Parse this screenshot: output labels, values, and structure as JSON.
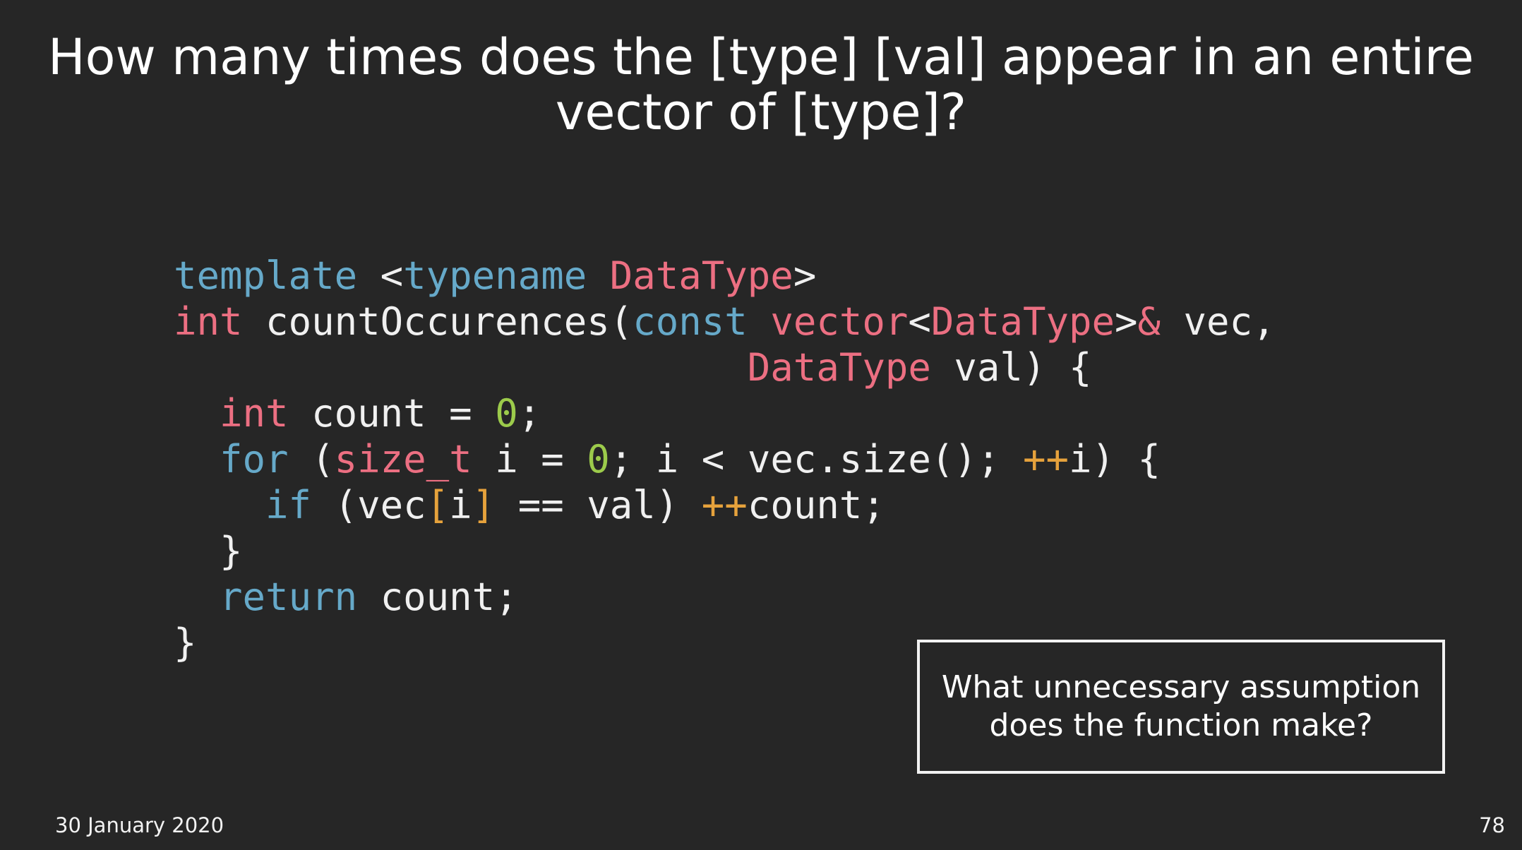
{
  "title": {
    "line1": "How many times does the [type] [val] appear in an entire",
    "line2": "vector of [type]?"
  },
  "code": {
    "lines": [
      [
        {
          "t": "template",
          "k": "kw"
        },
        {
          "t": " <",
          "k": "plain"
        },
        {
          "t": "typename",
          "k": "kw"
        },
        {
          "t": " ",
          "k": "plain"
        },
        {
          "t": "DataType",
          "k": "type"
        },
        {
          "t": ">",
          "k": "plain"
        }
      ],
      [
        {
          "t": "int",
          "k": "type"
        },
        {
          "t": " countOccurences(",
          "k": "plain"
        },
        {
          "t": "const",
          "k": "kw"
        },
        {
          "t": " ",
          "k": "plain"
        },
        {
          "t": "vector",
          "k": "type"
        },
        {
          "t": "<",
          "k": "plain"
        },
        {
          "t": "DataType",
          "k": "type"
        },
        {
          "t": ">",
          "k": "plain"
        },
        {
          "t": "&",
          "k": "type"
        },
        {
          "t": " vec,",
          "k": "plain"
        }
      ],
      [
        {
          "t": "                         ",
          "k": "plain"
        },
        {
          "t": "DataType",
          "k": "type"
        },
        {
          "t": " val) {",
          "k": "plain"
        }
      ],
      [
        {
          "t": "  ",
          "k": "plain"
        },
        {
          "t": "int",
          "k": "type"
        },
        {
          "t": " count = ",
          "k": "plain"
        },
        {
          "t": "0",
          "k": "num"
        },
        {
          "t": ";",
          "k": "plain"
        }
      ],
      [
        {
          "t": "  ",
          "k": "plain"
        },
        {
          "t": "for",
          "k": "kw"
        },
        {
          "t": " (",
          "k": "plain"
        },
        {
          "t": "size_t",
          "k": "type"
        },
        {
          "t": " i = ",
          "k": "plain"
        },
        {
          "t": "0",
          "k": "num"
        },
        {
          "t": "; i < vec.size(); ",
          "k": "plain"
        },
        {
          "t": "++",
          "k": "op"
        },
        {
          "t": "i) {",
          "k": "plain"
        }
      ],
      [
        {
          "t": "    ",
          "k": "plain"
        },
        {
          "t": "if",
          "k": "kw"
        },
        {
          "t": " (vec",
          "k": "plain"
        },
        {
          "t": "[",
          "k": "op"
        },
        {
          "t": "i",
          "k": "plain"
        },
        {
          "t": "]",
          "k": "op"
        },
        {
          "t": " == val) ",
          "k": "plain"
        },
        {
          "t": "++",
          "k": "op"
        },
        {
          "t": "count;",
          "k": "plain"
        }
      ],
      [
        {
          "t": "  }",
          "k": "plain"
        }
      ],
      [
        {
          "t": "  ",
          "k": "plain"
        },
        {
          "t": "return",
          "k": "kw"
        },
        {
          "t": " count;",
          "k": "plain"
        }
      ],
      [
        {
          "t": "}",
          "k": "plain"
        }
      ]
    ]
  },
  "callout": {
    "line1": "What unnecessary assumption",
    "line2": "does the function make?"
  },
  "footer": {
    "date": "30 January 2020",
    "page": "78"
  },
  "colors": {
    "background": "#262626",
    "keyword": "#66a9c9",
    "type": "#ec6f82",
    "number": "#9ccb4b",
    "operator": "#e6a23c"
  }
}
